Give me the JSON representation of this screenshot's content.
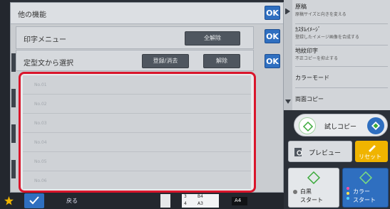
{
  "dialog": {
    "title": "他の機能",
    "ok_label": "OK"
  },
  "print_menu": {
    "title": "印字メニュー",
    "clear_all_label": "全解除",
    "ok_label": "OK"
  },
  "template_select": {
    "title": "定型文から選択",
    "register_label": "登録/消去",
    "release_label": "解除",
    "ok_label": "OK"
  },
  "template_list": [
    "No.01",
    "No.02",
    "No.03",
    "No.04",
    "No.05",
    "No.06"
  ],
  "right_menu": {
    "items": [
      {
        "title": "原稿",
        "sub": "原稿サイズと向きを変える"
      },
      {
        "title": "ｶｽﾀﾑｲﾒｰｼﾞ",
        "sub": "登録したイメージ画像を合成する"
      },
      {
        "title": "地紋印字",
        "sub": "不正コピーを抑止する"
      },
      {
        "title": "カラーモード",
        "sub": ""
      },
      {
        "title": "両面コピー",
        "sub": ""
      }
    ]
  },
  "actions": {
    "proof_copy": "試しコピー",
    "preview": "プレビュー",
    "reset": "リセット",
    "mono_start_line1": "白黒",
    "mono_start_line2": "スタート",
    "color_start_line1": "カラー",
    "color_start_line2": "スタート"
  },
  "bottom_bar": {
    "back_label": "戻る",
    "page_nums": [
      "3",
      "4"
    ],
    "paper_labels": [
      "B4",
      "A3",
      "A4"
    ]
  },
  "colors": {
    "ok_blue": "#2f6fc0",
    "highlight_red": "#d9152b",
    "reset_yellow": "#f0b400",
    "start_green": "#3aaa3a"
  }
}
